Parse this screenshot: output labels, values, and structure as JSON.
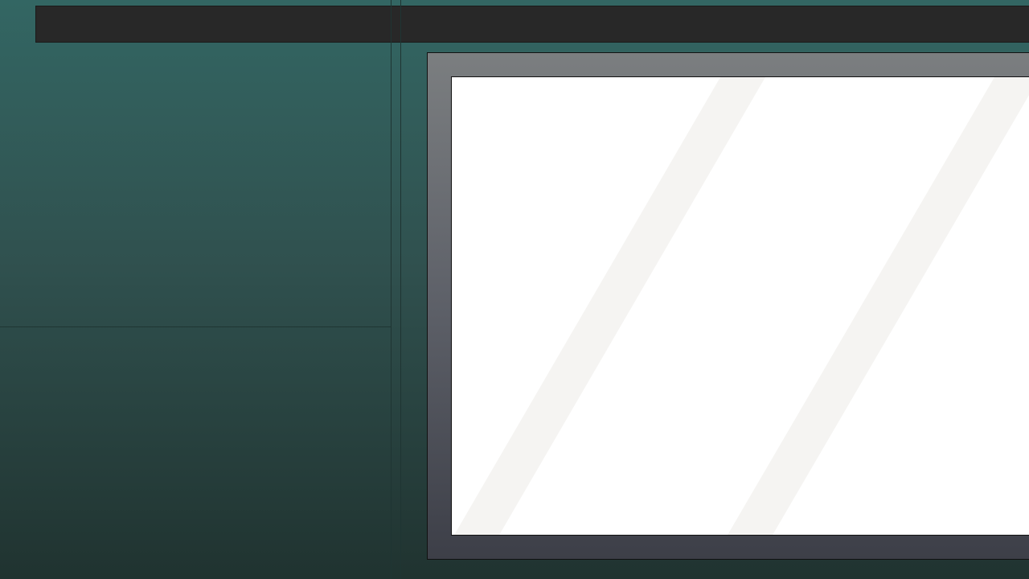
{
  "colors": {
    "background_top": "#336663",
    "background_bottom": "#203330",
    "toolbar": "#282828",
    "frame_top": "#7b7e80",
    "frame_bottom": "#3d3f48",
    "canvas": "#ffffff",
    "stripe": "#f5f4f2"
  },
  "icons": []
}
